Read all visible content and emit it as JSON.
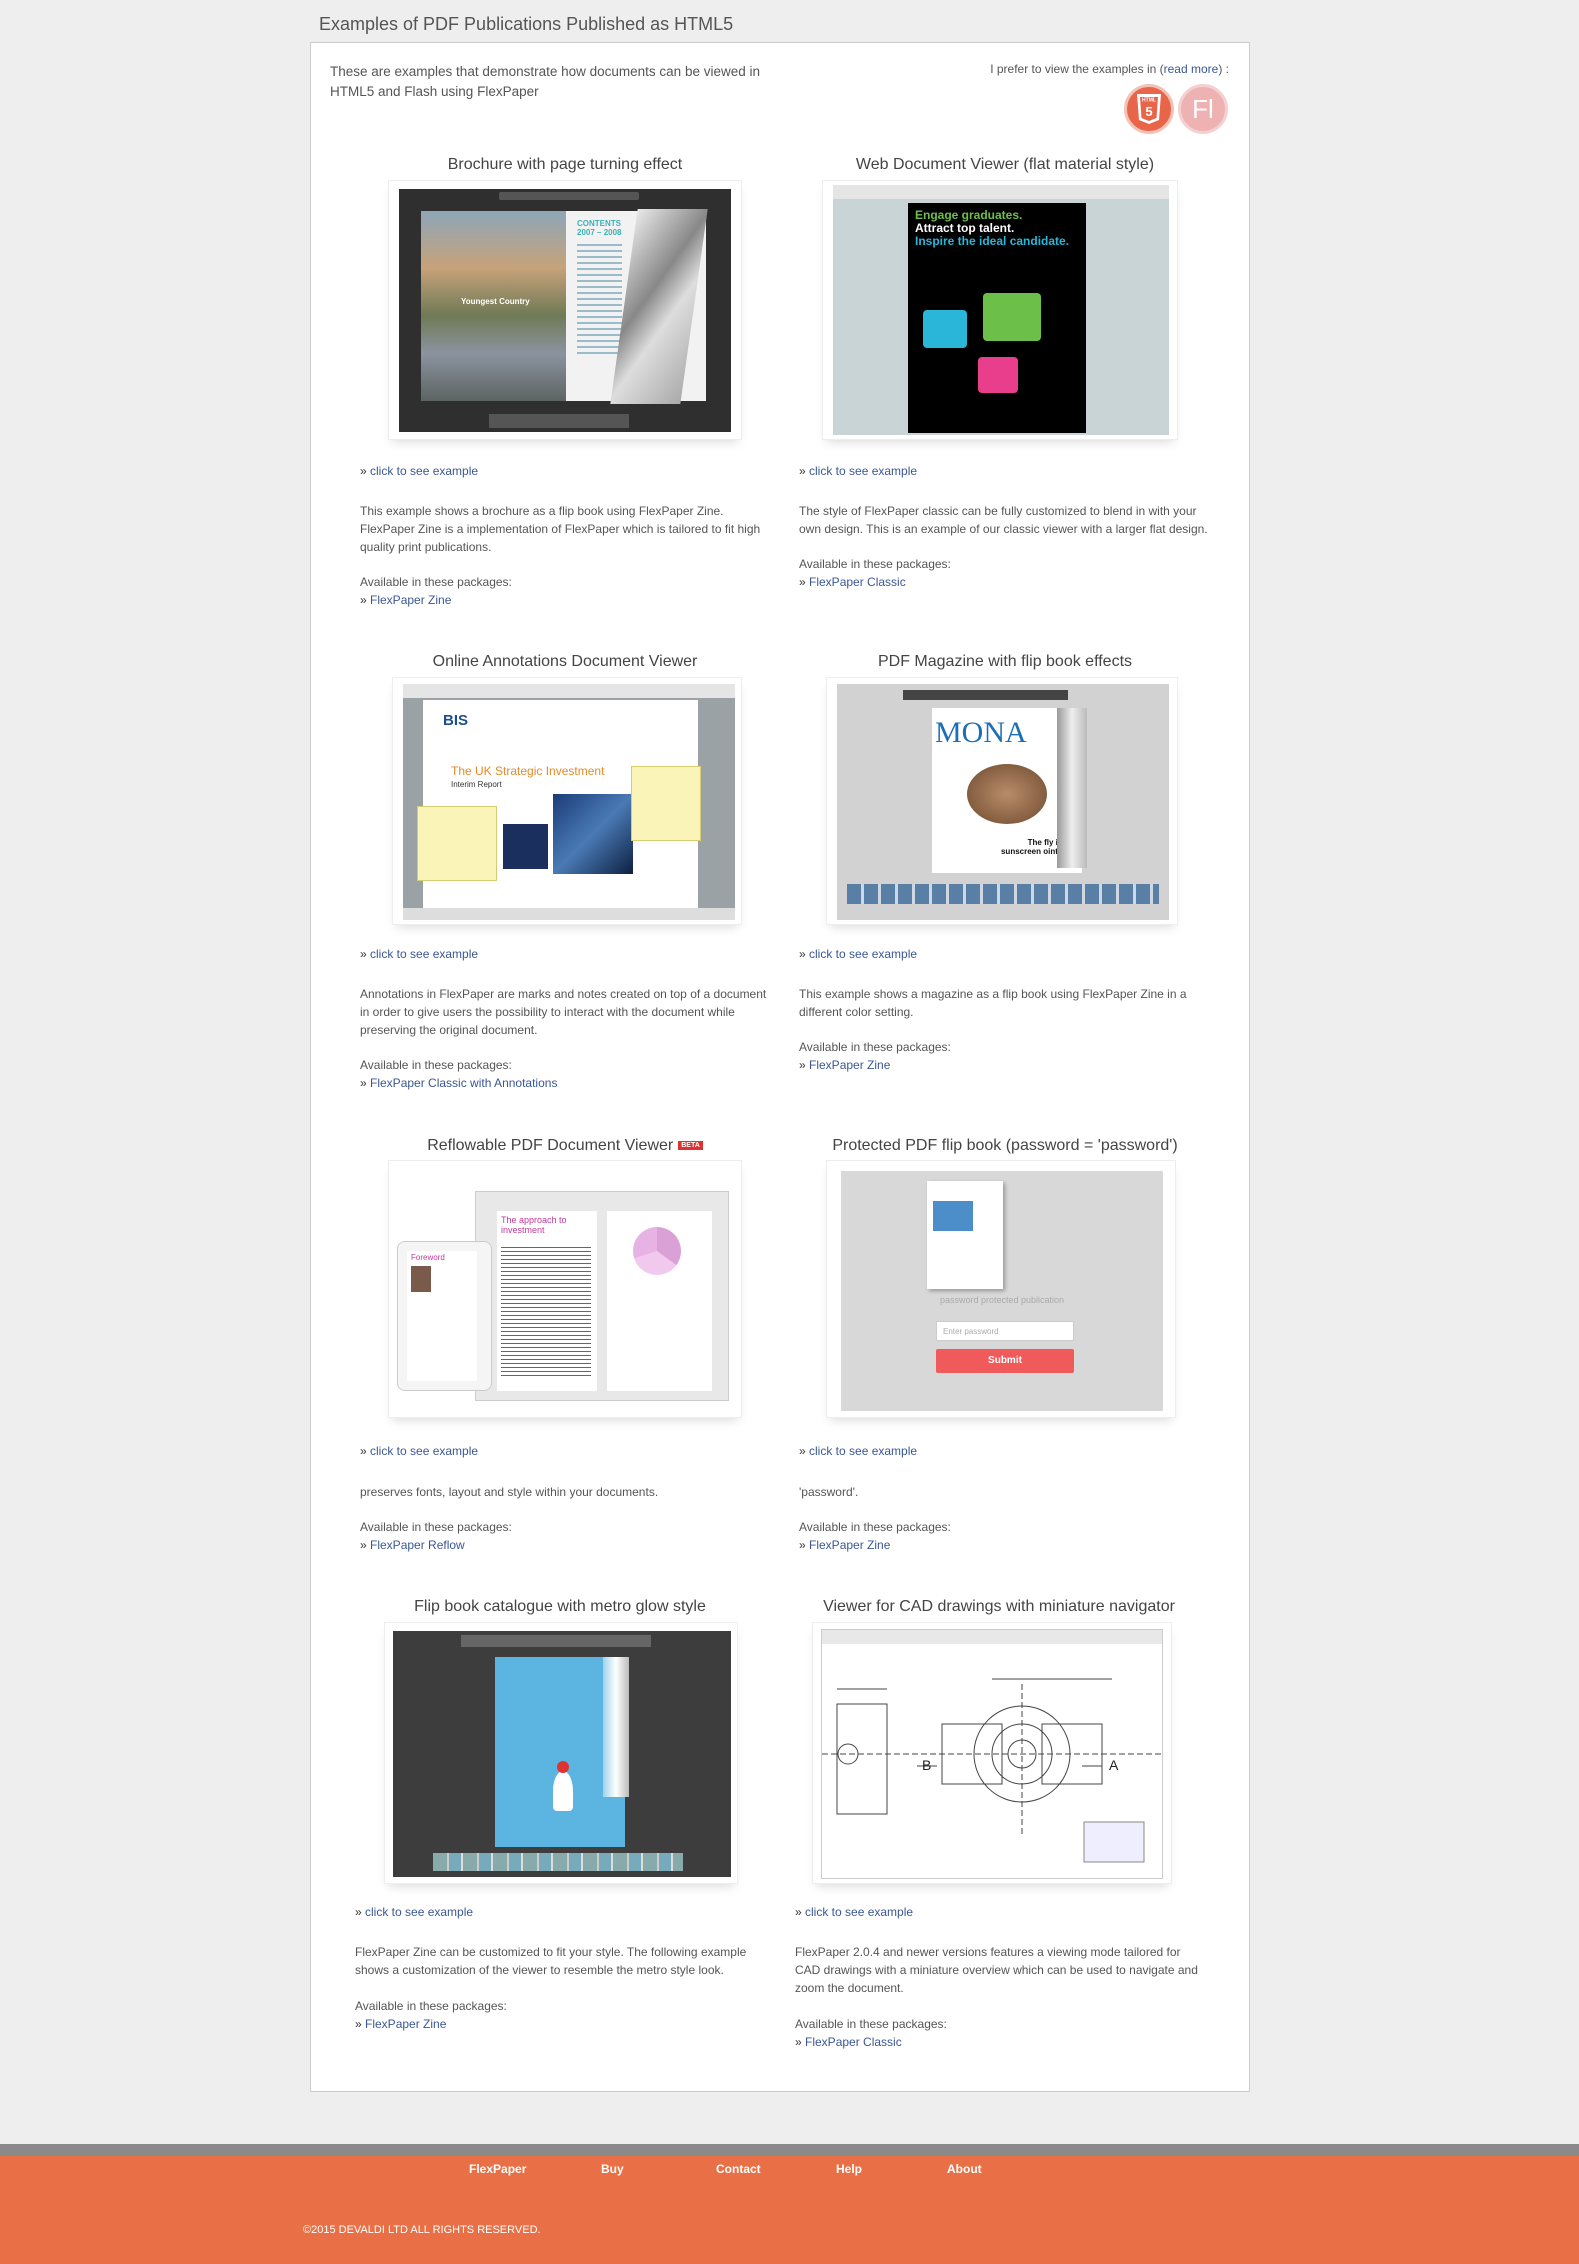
{
  "page": {
    "title": "Examples of PDF Publications Published as HTML5",
    "intro": "These are examples that demonstrate how documents can be viewed in HTML5 and Flash using FlexPaper",
    "prefer_text": "I prefer to view the examples in (",
    "read_more": "read more",
    "prefer_end": ") :",
    "format_html5_label": "HTML",
    "format_html5_num": "5",
    "format_flash_label": "Fl"
  },
  "colors": {
    "accent": "#e97046",
    "link": "#3a5795",
    "submit": "#f15a5a"
  },
  "examples": [
    {
      "title": "Brochure with page turning effect",
      "link": "click to see example",
      "desc": "This example shows a brochure as a flip book using FlexPaper Zine. FlexPaper Zine is a implementation of FlexPaper which is tailored to fit high quality print publications.",
      "avail": "Available in these packages:",
      "pkg": "FlexPaper Zine",
      "thumb_text_1": "CONTENTS 2007 – 2008",
      "thumb_text_2": "Youngest Country"
    },
    {
      "title": "Web Document Viewer (flat material style)",
      "link": "click to see example",
      "desc": "The style of FlexPaper classic can be fully customized to blend in with your own design. This is an example of our classic viewer with a larger flat design.",
      "avail": "Available in these packages:",
      "pkg": "FlexPaper Classic",
      "thumb_text_1": "Engage graduates.",
      "thumb_text_2": "Attract top talent.",
      "thumb_text_3": "Inspire the ideal candidate."
    },
    {
      "title": "Online Annotations Document Viewer",
      "link": "click to see example",
      "desc": "Annotations in FlexPaper are marks and notes created on top of a document in order to give users the possibility to interact with the document while preserving the original document.",
      "avail": "Available in these packages:",
      "pkg": "FlexPaper Classic with Annotations",
      "thumb_text_1": "BIS",
      "thumb_text_2": "The UK Strategic Investment",
      "thumb_text_3": "Interim Report"
    },
    {
      "title": "PDF Magazine with flip book effects",
      "link": "click to see example",
      "desc": "This example shows a magazine as a flip book using FlexPaper Zine in a different color setting.",
      "avail": "Available in these packages:",
      "pkg": "FlexPaper Zine",
      "thumb_text_1": "MONA",
      "thumb_text_2": "The fly in the sunscreen ointment"
    },
    {
      "title": "Reflowable PDF Document Viewer",
      "beta": "BETA",
      "link": "click to see example",
      "desc": "preserves fonts, layout and style within your documents.",
      "avail": "Available in these packages:",
      "pkg": "FlexPaper Reflow",
      "thumb_text_1": "The approach to investment",
      "thumb_text_2": "Foreword"
    },
    {
      "title": "Protected PDF flip book (password = 'password')",
      "link": "click to see example",
      "desc": "'password'.",
      "avail": "Available in these packages:",
      "pkg": "FlexPaper Zine",
      "thumb_text_1": "password protected publication",
      "thumb_placeholder": "Enter password",
      "thumb_button": "Submit"
    },
    {
      "title": "Flip book catalogue with metro glow style",
      "link": "click to see example",
      "desc": "FlexPaper Zine can be customized to fit your style. The following example shows a customization of the viewer to resemble the metro style look.",
      "avail": "Available in these packages:",
      "pkg": "FlexPaper Zine"
    },
    {
      "title": "Viewer for CAD drawings with miniature navigator",
      "link": "click to see example",
      "desc": "FlexPaper 2.0.4 and newer versions features a viewing mode tailored for CAD drawings with a miniature overview which can be used to navigate and zoom the document.",
      "avail": "Available in these packages:",
      "pkg": "FlexPaper Classic",
      "thumb_text_1": "B",
      "thumb_text_2": "A"
    }
  ],
  "footer": {
    "nav": [
      "FlexPaper",
      "Buy",
      "Contact",
      "Help",
      "About"
    ],
    "copyright": "©2015 DEVALDI LTD ALL RIGHTS RESERVED."
  }
}
